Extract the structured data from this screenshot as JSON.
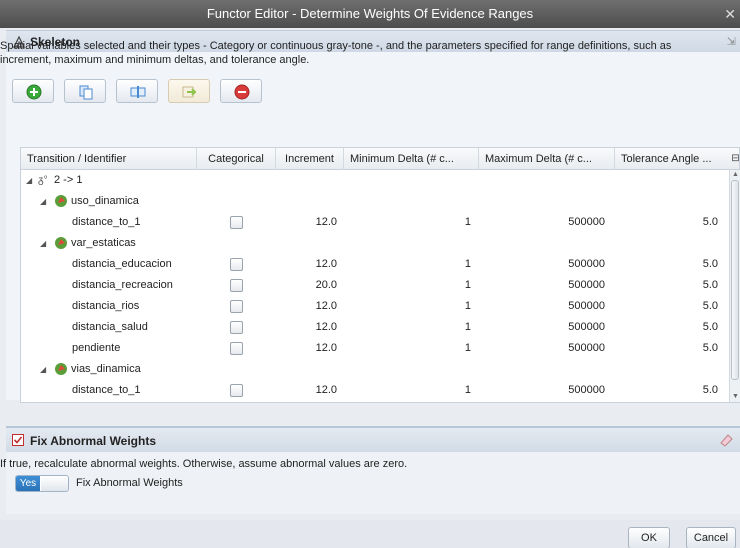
{
  "window": {
    "title": "Functor Editor - Determine Weights Of Evidence Ranges",
    "close_glyph": "✕"
  },
  "skeleton": {
    "title": "Skeleton",
    "description": "Spatial variables selected and their types - Category or continuous gray-tone -, and the parameters specified for range definitions, such as increment, maximum and minimum deltas, and tolerance angle."
  },
  "toolbar": {
    "buttons": [
      {
        "name": "add",
        "icon": "plus-circle-icon",
        "color": "#3aa83a"
      },
      {
        "name": "copy",
        "icon": "copy-icon",
        "color": "#4a8ad0"
      },
      {
        "name": "edit",
        "icon": "edit-icon",
        "color": "#4a8ad0"
      },
      {
        "name": "move",
        "icon": "arrow-right-icon",
        "color": "#8fc24a",
        "disabled": true
      },
      {
        "name": "remove",
        "icon": "minus-circle-icon",
        "color": "#d93a3a"
      }
    ]
  },
  "grid": {
    "columns": [
      "Transition / Identifier",
      "Categorical",
      "Increment",
      "Minimum Delta (# c...",
      "Maximum Delta (# c...",
      "Tolerance Angle ..."
    ],
    "transition": "2 -> 1",
    "groups": [
      {
        "name": "uso_dinamica",
        "rows": [
          {
            "id": "distance_to_1",
            "increment": "12.0",
            "min_delta": "1",
            "max_delta": "500000",
            "tolerance": "5.0"
          }
        ]
      },
      {
        "name": "var_estaticas",
        "rows": [
          {
            "id": "distancia_educacion",
            "increment": "12.0",
            "min_delta": "1",
            "max_delta": "500000",
            "tolerance": "5.0"
          },
          {
            "id": "distancia_recreacion",
            "increment": "20.0",
            "min_delta": "1",
            "max_delta": "500000",
            "tolerance": "5.0"
          },
          {
            "id": "distancia_rios",
            "increment": "12.0",
            "min_delta": "1",
            "max_delta": "500000",
            "tolerance": "5.0"
          },
          {
            "id": "distancia_salud",
            "increment": "12.0",
            "min_delta": "1",
            "max_delta": "500000",
            "tolerance": "5.0"
          },
          {
            "id": "pendiente",
            "increment": "12.0",
            "min_delta": "1",
            "max_delta": "500000",
            "tolerance": "5.0"
          }
        ]
      },
      {
        "name": "vias_dinamica",
        "rows": [
          {
            "id": "distance_to_1",
            "increment": "12.0",
            "min_delta": "1",
            "max_delta": "500000",
            "tolerance": "5.0"
          }
        ]
      }
    ]
  },
  "abnormal": {
    "title": "Fix Abnormal Weights",
    "description": "If true, recalculate abnormal weights. Otherwise, assume abnormal values are zero.",
    "toggle_value": "Yes",
    "toggle_label": "Fix Abnormal Weights"
  },
  "footer": {
    "ok_label": "OK",
    "cancel_label": "Cancel"
  }
}
